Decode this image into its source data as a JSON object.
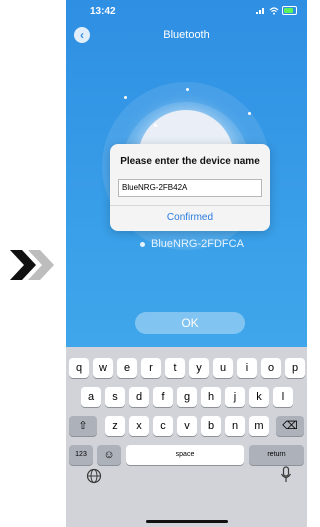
{
  "status_bar": {
    "time": "13:42"
  },
  "nav": {
    "title": "Bluetooth",
    "back_glyph": "‹"
  },
  "device": {
    "name": "BlueNRG-2FDFCA"
  },
  "dialog": {
    "title": "Please enter the device name",
    "input_value": "BlueNRG-2FB42A",
    "confirm_label": "Confirmed"
  },
  "ok_button": {
    "label": "OK"
  },
  "keyboard": {
    "row1": [
      "q",
      "w",
      "e",
      "r",
      "t",
      "y",
      "u",
      "i",
      "o",
      "p"
    ],
    "row2": [
      "a",
      "s",
      "d",
      "f",
      "g",
      "h",
      "j",
      "k",
      "l"
    ],
    "row3": [
      "z",
      "x",
      "c",
      "v",
      "b",
      "n",
      "m"
    ],
    "numbers_label": "123",
    "space_label": "space",
    "return_label": "return",
    "shift_glyph": "⇧",
    "delete_glyph": "⌫",
    "emoji_glyph": "☺"
  },
  "colors": {
    "accent": "#2a7ce0",
    "phone_bg": "#3aa0e9",
    "chevron_dark": "#111111",
    "chevron_light": "#bdbdbd"
  },
  "icons": [
    "double-chevron-right-icon",
    "back-icon",
    "signal-icon",
    "wifi-icon",
    "battery-icon",
    "globe-icon",
    "mic-icon"
  ]
}
